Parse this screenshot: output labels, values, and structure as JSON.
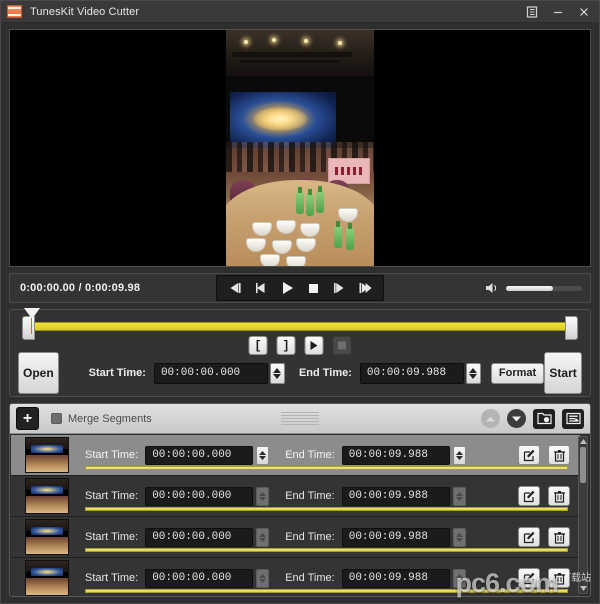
{
  "window": {
    "title": "TunesKit Video Cutter",
    "app_icon": "film-strip-icon",
    "menu_label": "☰",
    "minimize_label": "–",
    "close_label": "×"
  },
  "player": {
    "current_time": "0:00:00.00",
    "separator": "/",
    "total_time": "0:00:09.98",
    "timecode_full": "0:00:00.00 / 0:00:09.98",
    "controls": [
      {
        "name": "previous-frame-button",
        "label": "⏮"
      },
      {
        "name": "rewind-button",
        "label": "◀"
      },
      {
        "name": "play-button",
        "label": "▶"
      },
      {
        "name": "stop-button",
        "label": "■"
      },
      {
        "name": "fast-forward-button",
        "label": "▶"
      },
      {
        "name": "next-frame-button",
        "label": "⏭"
      }
    ],
    "volume": {
      "icon": "speaker-icon",
      "level_percent": 62
    }
  },
  "trim": {
    "mark_in_label": "[",
    "mark_out_label": "]",
    "preview_label": "▶",
    "stop_label": "■",
    "open_label": "Open",
    "start_time_label": "Start Time:",
    "start_time_value": "00:00:00.000",
    "end_time_label": "End Time:",
    "end_time_value": "00:00:09.988",
    "format_label": "Format",
    "start_label": "Start",
    "timeline": {
      "selection_start_percent": 0,
      "selection_end_percent": 100,
      "playhead_percent": 0
    }
  },
  "segments_panel": {
    "add_label": "+",
    "merge_label": "Merge Segments",
    "merge_checked": false,
    "tools": [
      {
        "name": "move-up-button",
        "icon": "chevron-up-icon",
        "enabled": false
      },
      {
        "name": "move-down-button",
        "icon": "chevron-down-icon",
        "enabled": true
      },
      {
        "name": "open-folder-button",
        "icon": "folder-media-icon",
        "enabled": true
      },
      {
        "name": "list-options-button",
        "icon": "list-settings-icon",
        "enabled": true
      }
    ],
    "column_labels": {
      "start": "Start Time:",
      "end": "End Time:"
    },
    "row_actions": {
      "edit": "edit-icon",
      "delete": "trash-icon"
    },
    "rows": [
      {
        "start": "00:00:00.000",
        "end": "00:00:09.988",
        "selected": true,
        "progress_percent": 100
      },
      {
        "start": "00:00:00.000",
        "end": "00:00:09.988",
        "selected": false,
        "progress_percent": 100
      },
      {
        "start": "00:00:00.000",
        "end": "00:00:09.988",
        "selected": false,
        "progress_percent": 100
      },
      {
        "start": "00:00:00.000",
        "end": "00:00:09.988",
        "selected": false,
        "progress_percent": 100
      }
    ]
  },
  "watermark": {
    "main": "pc6.com",
    "sub": "下载站"
  }
}
